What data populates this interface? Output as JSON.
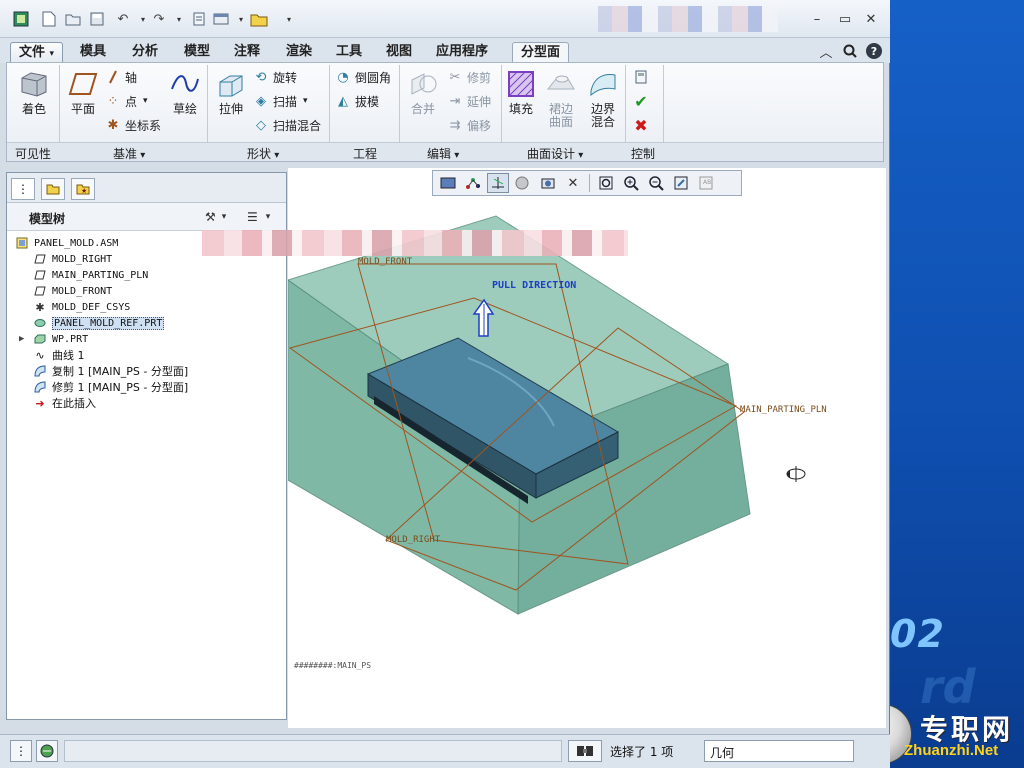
{
  "ribbon_tabs": [
    {
      "label": "文件"
    },
    {
      "label": "模具"
    },
    {
      "label": "分析"
    },
    {
      "label": "模型"
    },
    {
      "label": "注释"
    },
    {
      "label": "渲染"
    },
    {
      "label": "工具"
    },
    {
      "label": "视图"
    },
    {
      "label": "应用程序"
    },
    {
      "label": "分型面"
    }
  ],
  "ribbon": {
    "visibility": {
      "shade": "着色",
      "group": "可见性"
    },
    "datum": {
      "plane": "平面",
      "axis": "轴",
      "point": "点",
      "csys": "坐标系",
      "sketch": "草绘",
      "group": "基准"
    },
    "shapes": {
      "extrude": "拉伸",
      "revolve": "旋转",
      "sweep": "扫描",
      "swept_blend": "扫描混合",
      "group": "形状"
    },
    "engineering": {
      "round": "倒圆角",
      "draft": "拔模",
      "group": "工程"
    },
    "editing": {
      "merge": "合并",
      "trim": "修剪",
      "extend": "延伸",
      "offset": "偏移",
      "group": "编辑"
    },
    "surface": {
      "fill": "填充",
      "skirt_line1": "裙边",
      "skirt_line2": "曲面",
      "boundary_line1": "边界",
      "boundary_line2": "混合",
      "group": "曲面设计"
    },
    "control": {
      "group": "控制"
    }
  },
  "model_tree": {
    "title": "模型树",
    "items": [
      {
        "label": "PANEL_MOLD.ASM",
        "icon": "assembly-icon"
      },
      {
        "label": "MOLD_RIGHT",
        "icon": "datum-plane-icon"
      },
      {
        "label": "MAIN_PARTING_PLN",
        "icon": "datum-plane-icon"
      },
      {
        "label": "MOLD_FRONT",
        "icon": "datum-plane-icon"
      },
      {
        "label": "MOLD_DEF_CSYS",
        "icon": "csys-icon"
      },
      {
        "label": "PANEL_MOLD_REF.PRT",
        "icon": "part-icon"
      },
      {
        "label": "WP.PRT",
        "icon": "workpiece-icon"
      },
      {
        "label": "曲线 1",
        "icon": "curve-icon"
      },
      {
        "label": "复制 1 [MAIN_PS - 分型面]",
        "icon": "surface-icon"
      },
      {
        "label": "修剪 1 [MAIN_PS - 分型面]",
        "icon": "surface-icon"
      },
      {
        "label": "在此插入",
        "icon": "insert-here-icon"
      }
    ]
  },
  "viewport": {
    "labels": {
      "mold_front": "MOLD_FRONT",
      "pull_direction": "PULL DIRECTION",
      "main_parting_pln": "MAIN_PARTING_PLN",
      "mold_right": "MOLD_RIGHT",
      "footer": "########:MAIN_PS"
    },
    "colors": {
      "workpiece": "#6fb3a0",
      "part": "#3f6f86",
      "datum": "#a0541e"
    }
  },
  "status": {
    "selection": "选择了 1 项",
    "filter": "几何"
  },
  "watermark": {
    "number": "02",
    "cn": "专职网",
    "en": "Zhuanzhi.Net"
  }
}
